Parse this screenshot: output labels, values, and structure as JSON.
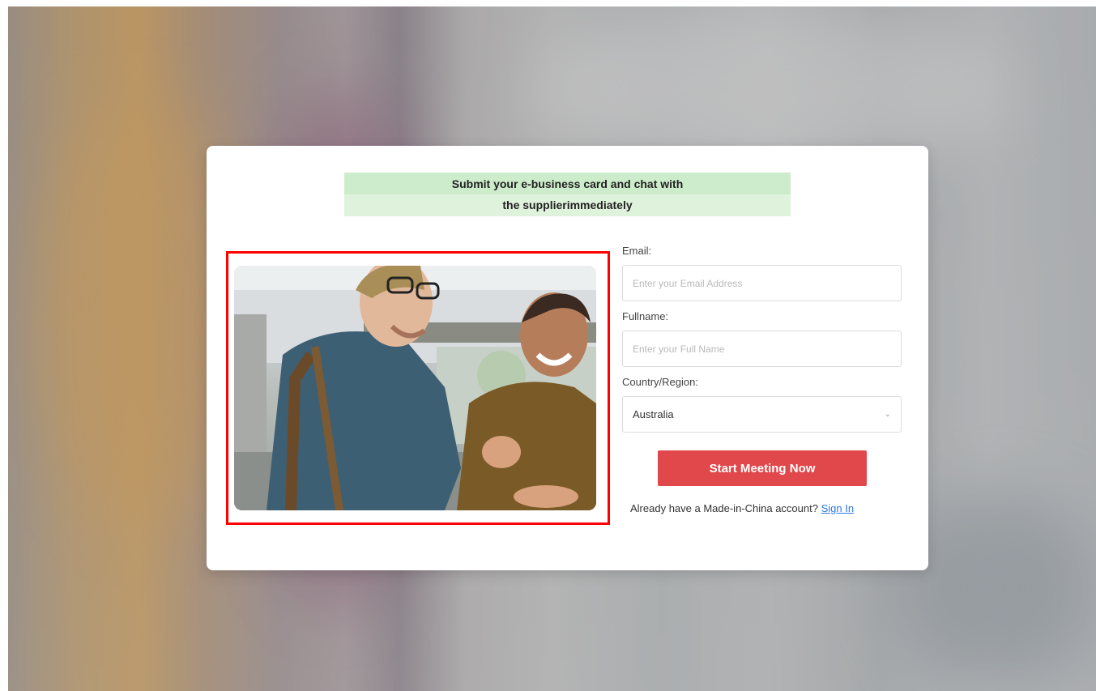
{
  "modal": {
    "headline_line1": "Submit your e-business card and chat with",
    "headline_line2": "the supplierimmediately",
    "image_alt": "two men talking and laughing"
  },
  "form": {
    "email_label": "Email:",
    "email_placeholder": "Enter your Email Address",
    "email_value": "",
    "fullname_label": "Fullname:",
    "fullname_placeholder": "Enter your Full Name",
    "fullname_value": "",
    "country_label": "Country/Region:",
    "country_value": "Australia",
    "submit_label": "Start Meeting Now",
    "account_prompt": "Already have a Made-in-China account?",
    "sign_in_label": "Sign In"
  },
  "colors": {
    "accent": "#e1484b",
    "headline_bg": "#dff3dc",
    "link": "#2a7be4",
    "highlight_border": "#ff0000"
  }
}
